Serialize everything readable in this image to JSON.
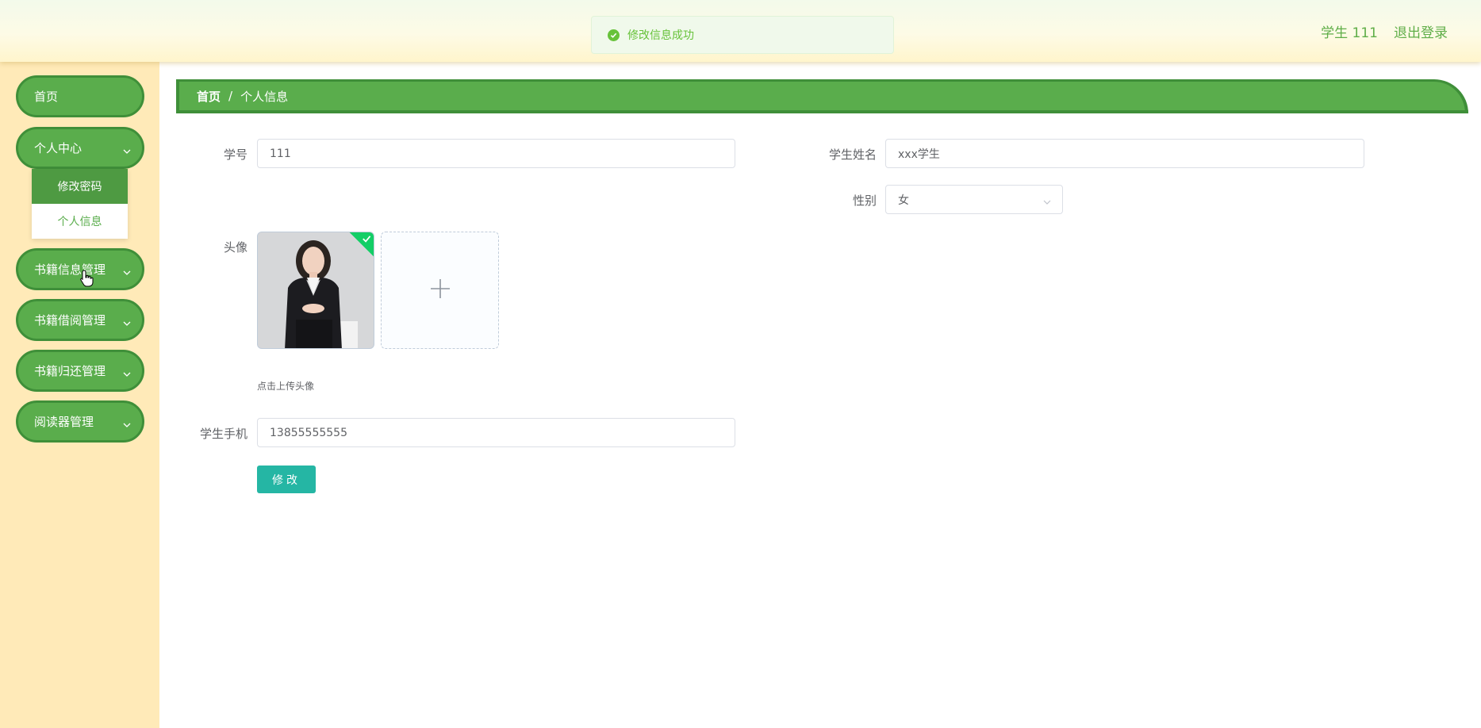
{
  "header": {
    "user_name": "学生 111",
    "logout_label": "退出登录"
  },
  "toast": {
    "message": "修改信息成功",
    "status_color": "#67c23a"
  },
  "sidebar": {
    "items": [
      {
        "label": "首页"
      },
      {
        "label": "个人中心",
        "expanded": true,
        "children": [
          {
            "label": "修改密码",
            "active": true
          },
          {
            "label": "个人信息",
            "active": false
          }
        ]
      },
      {
        "label": "书籍信息管理"
      },
      {
        "label": "书籍借阅管理"
      },
      {
        "label": "书籍归还管理"
      },
      {
        "label": "阅读器管理"
      }
    ]
  },
  "breadcrumb": {
    "home": "首页",
    "separator": "/",
    "current": "个人信息"
  },
  "form": {
    "student_id_label": "学号",
    "student_id_value": "111",
    "student_name_label": "学生姓名",
    "student_name_value": "xxx学生",
    "gender_label": "性别",
    "gender_value": "女",
    "avatar_label": "头像",
    "upload_tip": "点击上传头像",
    "phone_label": "学生手机",
    "phone_value": "13855555555",
    "submit_label": "修改"
  },
  "colors": {
    "sidebar_bg": "#ffeab8",
    "menu_green": "#5aad4c",
    "menu_border": "#3f8f39",
    "submit_button": "#25b6a4"
  }
}
